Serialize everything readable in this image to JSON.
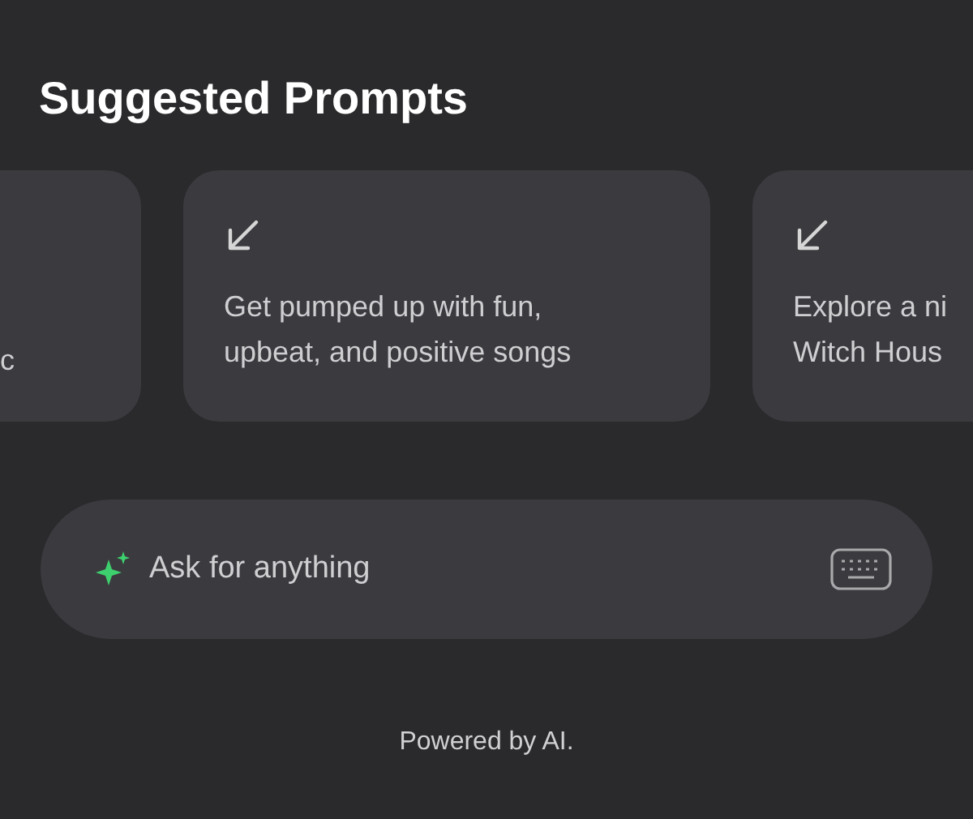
{
  "title": "Suggested Prompts",
  "prompts": [
    {
      "kind": "clipped_left",
      "lines": [
        "c"
      ]
    },
    {
      "kind": "full",
      "lines": [
        "Get pumped up with fun,",
        "upbeat, and positive songs"
      ]
    },
    {
      "kind": "clipped_right",
      "lines": [
        "Explore a ni",
        "Witch Hous"
      ]
    }
  ],
  "input": {
    "placeholder": "Ask for anything"
  },
  "footer": "Powered by AI."
}
